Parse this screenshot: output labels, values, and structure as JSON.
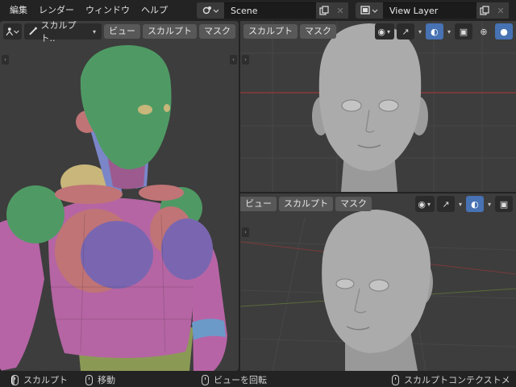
{
  "menu": [
    "編集",
    "レンダー",
    "ウィンドウ",
    "ヘルプ"
  ],
  "scene": {
    "icon": "scene-icon",
    "name": "Scene"
  },
  "view_layer": {
    "icon": "view-layer-icon",
    "name": "View Layer"
  },
  "left_view": {
    "mode_label": "スカルプト..",
    "buttons": [
      "ビュー",
      "スカルプト",
      "マスク"
    ]
  },
  "top_right_view": {
    "buttons": [
      "スカルプト",
      "マスク"
    ]
  },
  "bottom_right_view": {
    "buttons": [
      "ビュー",
      "スカルプト",
      "マスク"
    ]
  },
  "statusbar": {
    "left": "スカルプト",
    "middle_left": "移動",
    "middle": "ビューを回転",
    "right": "スカルプトコンテクストメ"
  },
  "colors": {
    "viewport_bg": "#3d3d3d",
    "active_blue": "#4772b3",
    "skin_green": "#4f9a64",
    "body_pink": "#b566a4",
    "purple": "#7a66b0",
    "salmon": "#c07476",
    "sculpt_grey": "#a8a8a8"
  }
}
